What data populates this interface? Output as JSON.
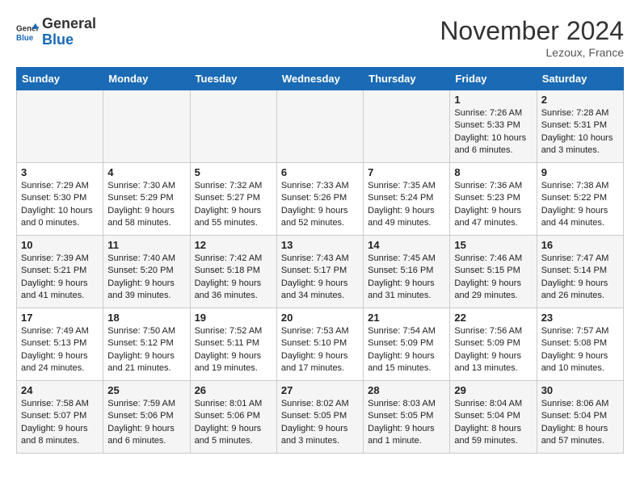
{
  "header": {
    "logo_line1": "General",
    "logo_line2": "Blue",
    "month": "November 2024",
    "location": "Lezoux, France"
  },
  "days_of_week": [
    "Sunday",
    "Monday",
    "Tuesday",
    "Wednesday",
    "Thursday",
    "Friday",
    "Saturday"
  ],
  "weeks": [
    [
      {
        "day": "",
        "info": ""
      },
      {
        "day": "",
        "info": ""
      },
      {
        "day": "",
        "info": ""
      },
      {
        "day": "",
        "info": ""
      },
      {
        "day": "",
        "info": ""
      },
      {
        "day": "1",
        "info": "Sunrise: 7:26 AM\nSunset: 5:33 PM\nDaylight: 10 hours and 6 minutes."
      },
      {
        "day": "2",
        "info": "Sunrise: 7:28 AM\nSunset: 5:31 PM\nDaylight: 10 hours and 3 minutes."
      }
    ],
    [
      {
        "day": "3",
        "info": "Sunrise: 7:29 AM\nSunset: 5:30 PM\nDaylight: 10 hours and 0 minutes."
      },
      {
        "day": "4",
        "info": "Sunrise: 7:30 AM\nSunset: 5:29 PM\nDaylight: 9 hours and 58 minutes."
      },
      {
        "day": "5",
        "info": "Sunrise: 7:32 AM\nSunset: 5:27 PM\nDaylight: 9 hours and 55 minutes."
      },
      {
        "day": "6",
        "info": "Sunrise: 7:33 AM\nSunset: 5:26 PM\nDaylight: 9 hours and 52 minutes."
      },
      {
        "day": "7",
        "info": "Sunrise: 7:35 AM\nSunset: 5:24 PM\nDaylight: 9 hours and 49 minutes."
      },
      {
        "day": "8",
        "info": "Sunrise: 7:36 AM\nSunset: 5:23 PM\nDaylight: 9 hours and 47 minutes."
      },
      {
        "day": "9",
        "info": "Sunrise: 7:38 AM\nSunset: 5:22 PM\nDaylight: 9 hours and 44 minutes."
      }
    ],
    [
      {
        "day": "10",
        "info": "Sunrise: 7:39 AM\nSunset: 5:21 PM\nDaylight: 9 hours and 41 minutes."
      },
      {
        "day": "11",
        "info": "Sunrise: 7:40 AM\nSunset: 5:20 PM\nDaylight: 9 hours and 39 minutes."
      },
      {
        "day": "12",
        "info": "Sunrise: 7:42 AM\nSunset: 5:18 PM\nDaylight: 9 hours and 36 minutes."
      },
      {
        "day": "13",
        "info": "Sunrise: 7:43 AM\nSunset: 5:17 PM\nDaylight: 9 hours and 34 minutes."
      },
      {
        "day": "14",
        "info": "Sunrise: 7:45 AM\nSunset: 5:16 PM\nDaylight: 9 hours and 31 minutes."
      },
      {
        "day": "15",
        "info": "Sunrise: 7:46 AM\nSunset: 5:15 PM\nDaylight: 9 hours and 29 minutes."
      },
      {
        "day": "16",
        "info": "Sunrise: 7:47 AM\nSunset: 5:14 PM\nDaylight: 9 hours and 26 minutes."
      }
    ],
    [
      {
        "day": "17",
        "info": "Sunrise: 7:49 AM\nSunset: 5:13 PM\nDaylight: 9 hours and 24 minutes."
      },
      {
        "day": "18",
        "info": "Sunrise: 7:50 AM\nSunset: 5:12 PM\nDaylight: 9 hours and 21 minutes."
      },
      {
        "day": "19",
        "info": "Sunrise: 7:52 AM\nSunset: 5:11 PM\nDaylight: 9 hours and 19 minutes."
      },
      {
        "day": "20",
        "info": "Sunrise: 7:53 AM\nSunset: 5:10 PM\nDaylight: 9 hours and 17 minutes."
      },
      {
        "day": "21",
        "info": "Sunrise: 7:54 AM\nSunset: 5:09 PM\nDaylight: 9 hours and 15 minutes."
      },
      {
        "day": "22",
        "info": "Sunrise: 7:56 AM\nSunset: 5:09 PM\nDaylight: 9 hours and 13 minutes."
      },
      {
        "day": "23",
        "info": "Sunrise: 7:57 AM\nSunset: 5:08 PM\nDaylight: 9 hours and 10 minutes."
      }
    ],
    [
      {
        "day": "24",
        "info": "Sunrise: 7:58 AM\nSunset: 5:07 PM\nDaylight: 9 hours and 8 minutes."
      },
      {
        "day": "25",
        "info": "Sunrise: 7:59 AM\nSunset: 5:06 PM\nDaylight: 9 hours and 6 minutes."
      },
      {
        "day": "26",
        "info": "Sunrise: 8:01 AM\nSunset: 5:06 PM\nDaylight: 9 hours and 5 minutes."
      },
      {
        "day": "27",
        "info": "Sunrise: 8:02 AM\nSunset: 5:05 PM\nDaylight: 9 hours and 3 minutes."
      },
      {
        "day": "28",
        "info": "Sunrise: 8:03 AM\nSunset: 5:05 PM\nDaylight: 9 hours and 1 minute."
      },
      {
        "day": "29",
        "info": "Sunrise: 8:04 AM\nSunset: 5:04 PM\nDaylight: 8 hours and 59 minutes."
      },
      {
        "day": "30",
        "info": "Sunrise: 8:06 AM\nSunset: 5:04 PM\nDaylight: 8 hours and 57 minutes."
      }
    ]
  ]
}
